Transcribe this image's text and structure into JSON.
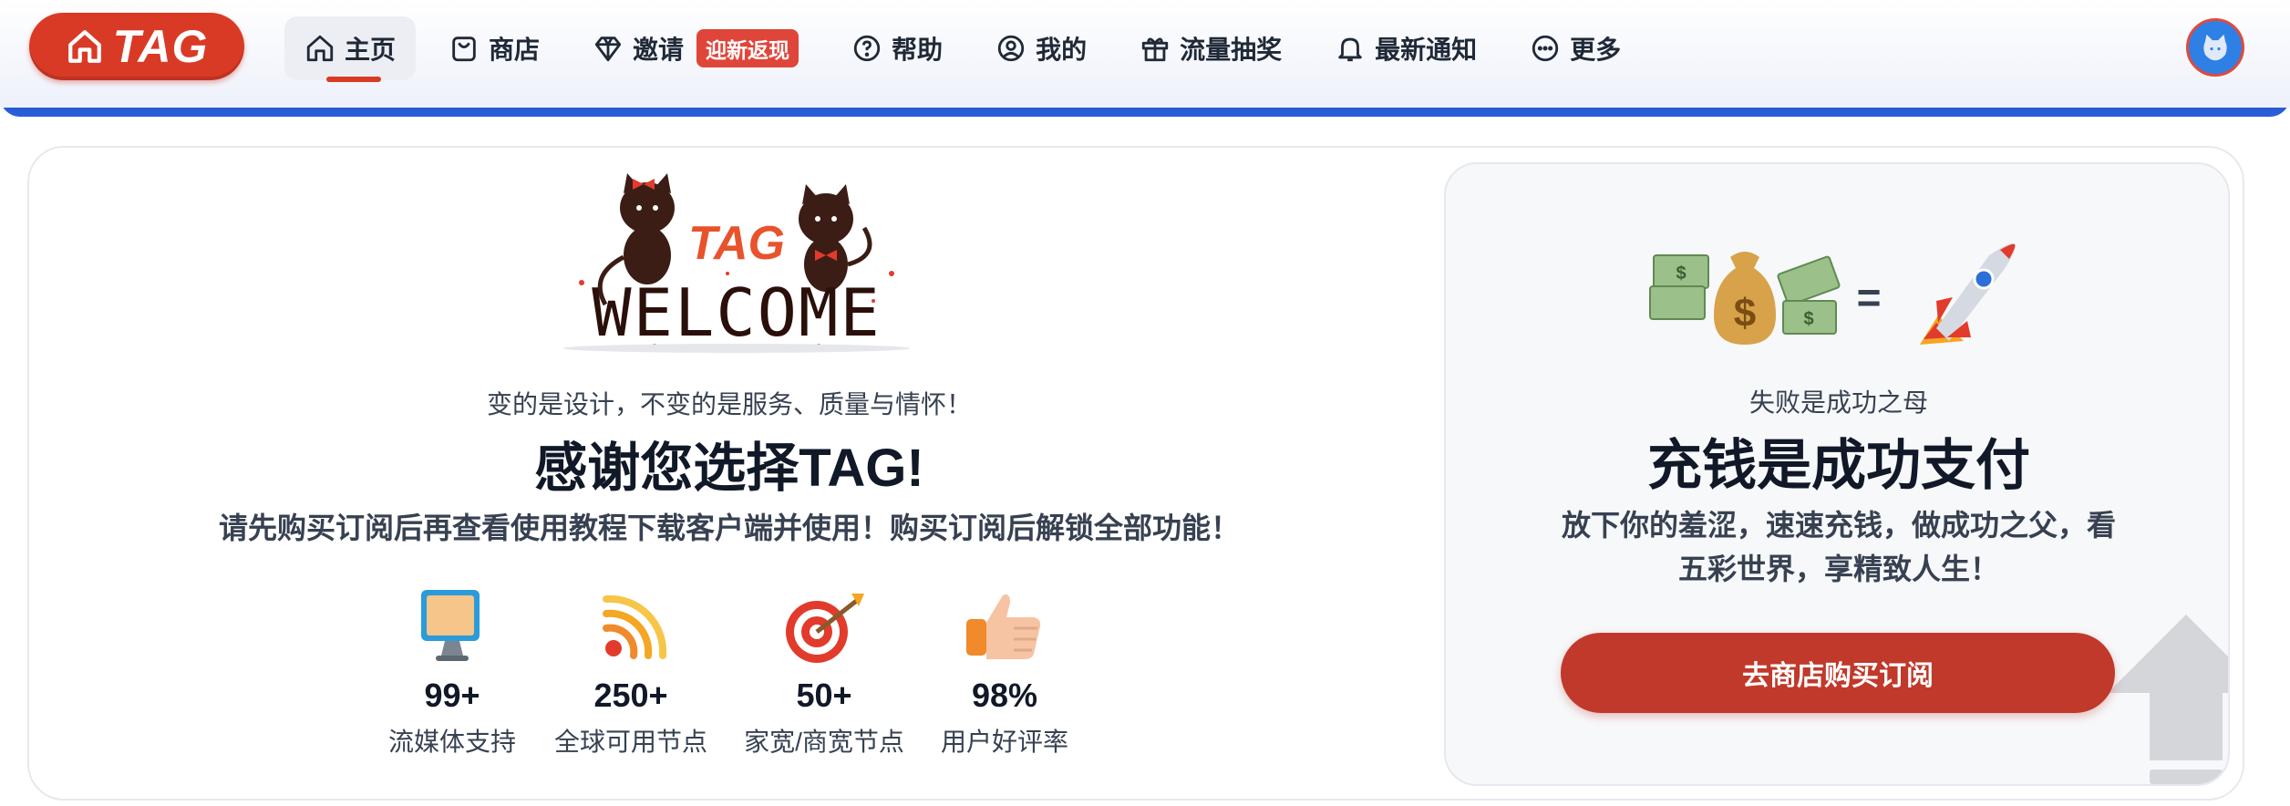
{
  "logo": {
    "text": "TAG"
  },
  "nav": {
    "items": [
      {
        "label": "主页",
        "icon": "home-icon"
      },
      {
        "label": "商店",
        "icon": "shopping-bag-icon"
      },
      {
        "label": "邀请",
        "icon": "diamond-icon",
        "badge": "迎新返现"
      },
      {
        "label": "帮助",
        "icon": "help-circle-icon"
      },
      {
        "label": "我的",
        "icon": "user-icon"
      },
      {
        "label": "流量抽奖",
        "icon": "gift-icon"
      },
      {
        "label": "最新通知",
        "icon": "bell-icon"
      },
      {
        "label": "更多",
        "icon": "more-icon"
      }
    ],
    "active_index": 0
  },
  "welcome": {
    "art_text": "WELCOME",
    "art_brand": "TAG",
    "subtitle": "变的是设计，不变的是服务、质量与情怀！",
    "headline": "感谢您选择TAG!",
    "description": "请先购买订阅后再查看使用教程下载客户端并使用！购买订阅后解锁全部功能！"
  },
  "stats": [
    {
      "value": "99+",
      "label": "流媒体支持",
      "icon": "monitor-icon"
    },
    {
      "value": "250+",
      "label": "全球可用节点",
      "icon": "wifi-icon"
    },
    {
      "value": "50+",
      "label": "家宽/商宽节点",
      "icon": "target-icon"
    },
    {
      "value": "98%",
      "label": "用户好评率",
      "icon": "thumbs-up-icon"
    }
  ],
  "promo": {
    "subtitle": "失败是成功之母",
    "headline": "充钱是成功支付",
    "description": "放下你的羞涩，速速充钱，做成功之父，看五彩世界，享精致人生！",
    "cta_label": "去商店购买订阅",
    "equation_symbol": "="
  },
  "colors": {
    "brand_red": "#d93a26",
    "accent_blue": "#2b5ed9",
    "cta_red": "#c0392b"
  }
}
